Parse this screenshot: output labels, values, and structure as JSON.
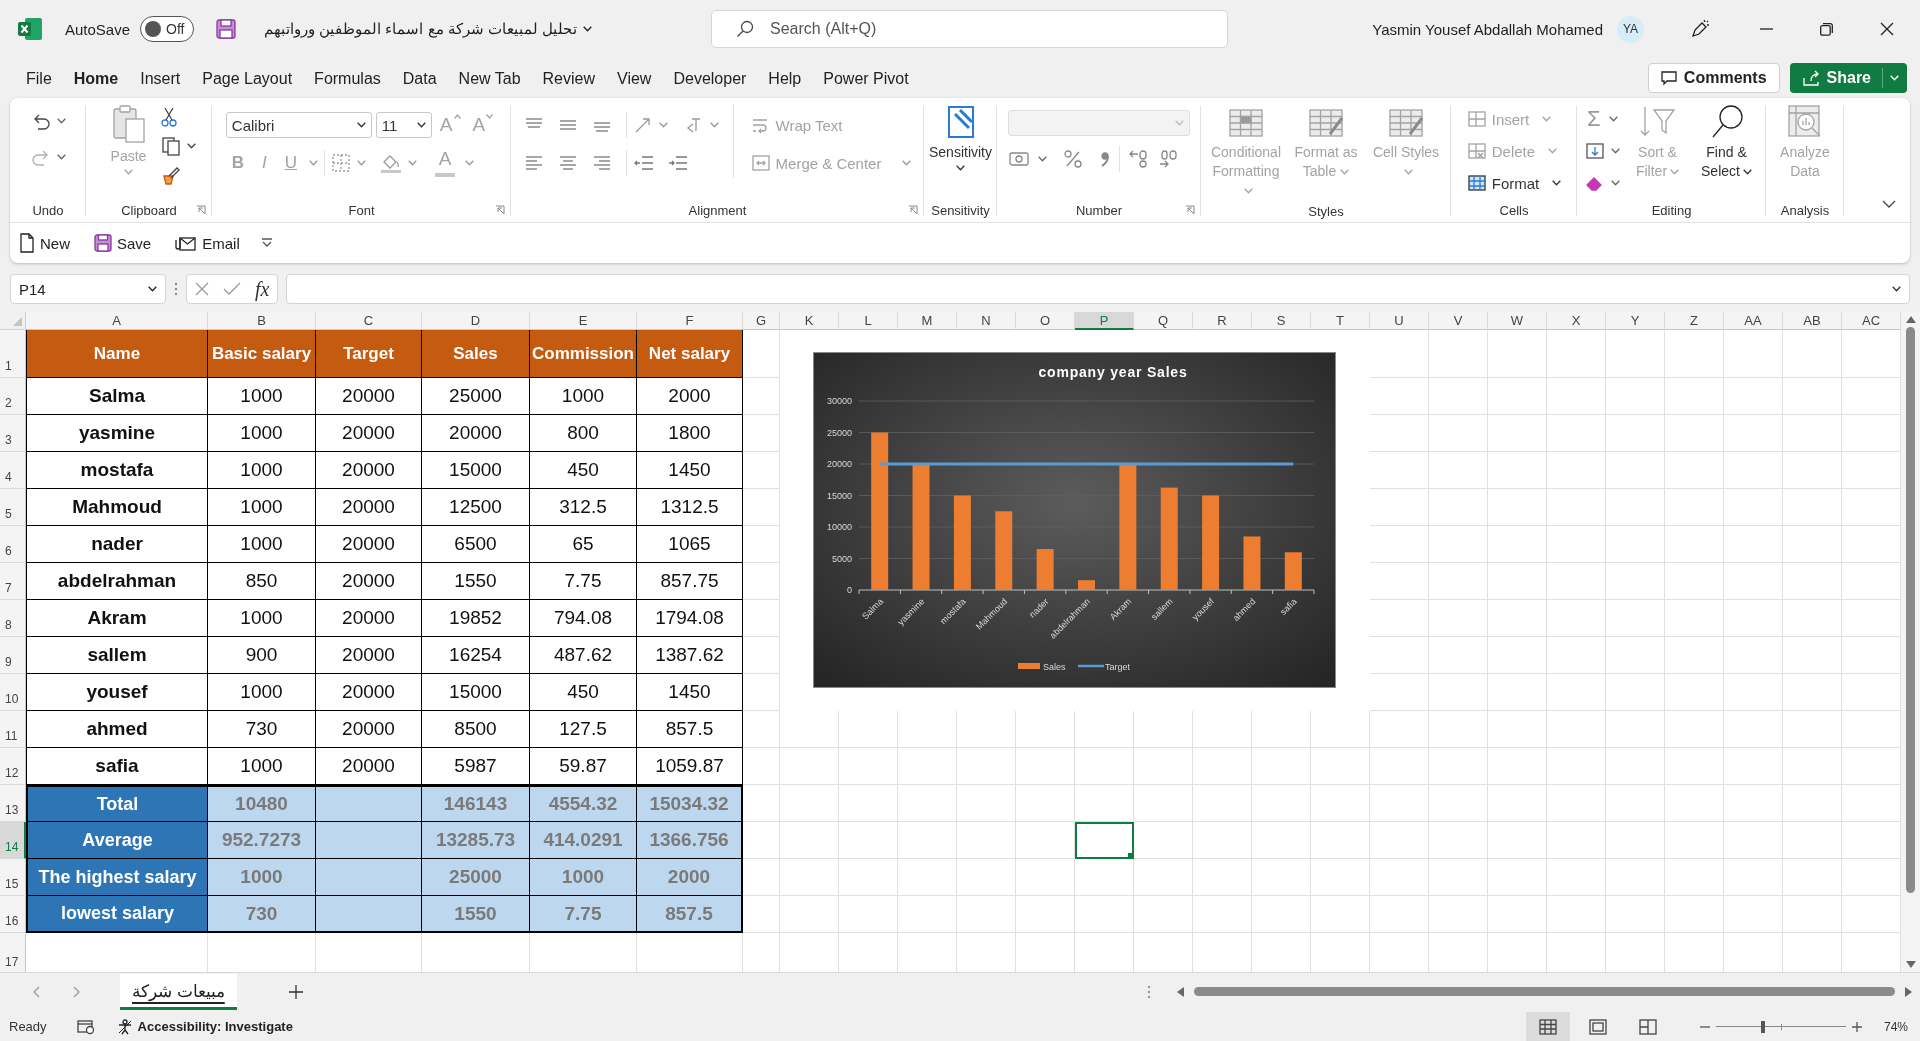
{
  "title_bar": {
    "autosave_label": "AutoSave",
    "autosave": {
      "on": false,
      "label": "Off"
    },
    "file_name": "تحليل لمبيعات شركة مع اسماء الموظفين ورواتبهم",
    "search": {
      "placeholder": "Search (Alt+Q)"
    },
    "user_name": "Yasmin Yousef Abdallah Mohamed",
    "avatar_initials": "YA"
  },
  "menu_tabs": [
    {
      "label": "File",
      "selected": false
    },
    {
      "label": "Home",
      "selected": true
    },
    {
      "label": "Insert",
      "selected": false
    },
    {
      "label": "Page Layout",
      "selected": false
    },
    {
      "label": "Formulas",
      "selected": false
    },
    {
      "label": "Data",
      "selected": false
    },
    {
      "label": "New Tab",
      "selected": false
    },
    {
      "label": "Review",
      "selected": false
    },
    {
      "label": "View",
      "selected": false
    },
    {
      "label": "Developer",
      "selected": false
    },
    {
      "label": "Help",
      "selected": false
    },
    {
      "label": "Power Pivot",
      "selected": false
    }
  ],
  "comments_button": "Comments",
  "share_button": "Share",
  "ribbon": {
    "groups": [
      {
        "kind": "undo",
        "label": "Undo",
        "launcher": false,
        "items": [
          {
            "disabled": false
          },
          {
            "disabled": true
          }
        ]
      },
      {
        "kind": "clipboard",
        "label": "Clipboard",
        "launcher": true,
        "paste": {
          "label": "Paste",
          "disabled": true
        }
      },
      {
        "kind": "font",
        "label": "Font",
        "launcher": true,
        "font_name": "Calibri",
        "font_size": "11",
        "size_buttons": [
          "A",
          "A"
        ],
        "style_buttons": [
          "B",
          "I",
          "U"
        ],
        "font_color": "A"
      },
      {
        "kind": "alignment",
        "label": "Alignment",
        "launcher": true,
        "buttons": [
          {
            "label": "Wrap Text",
            "disabled": true
          },
          {
            "label": "Merge & Center",
            "disabled": true
          }
        ]
      },
      {
        "kind": "large",
        "label": "Sensitivity",
        "launcher": false,
        "buttons": [
          {
            "label": "Sensitivity",
            "disabled": false
          }
        ]
      },
      {
        "kind": "number",
        "label": "Number",
        "launcher": true
      },
      {
        "kind": "large",
        "label": "Styles",
        "launcher": false,
        "buttons": [
          {
            "label": "Conditional Formatting",
            "disabled": true
          },
          {
            "label": "Format as Table",
            "disabled": true
          },
          {
            "label": "Cell Styles",
            "disabled": true
          }
        ]
      },
      {
        "kind": "cells",
        "label": "Cells",
        "launcher": false,
        "buttons": [
          {
            "label": "Insert",
            "disabled": true
          },
          {
            "label": "Delete",
            "disabled": true
          },
          {
            "label": "Format",
            "disabled": false
          }
        ]
      },
      {
        "kind": "editing",
        "label": "Editing",
        "launcher": false,
        "autosum": "Σ",
        "buttons": [
          {
            "label": "Sort & Filter",
            "disabled": true
          },
          {
            "label": "Find & Select",
            "disabled": false
          }
        ]
      },
      {
        "kind": "large",
        "label": "Analysis",
        "launcher": false,
        "buttons": [
          {
            "label": "Analyze Data",
            "disabled": true
          }
        ]
      }
    ]
  },
  "quick_access": [
    {
      "label": "New"
    },
    {
      "label": "Save"
    },
    {
      "label": "Email"
    }
  ],
  "formula_bar": {
    "name_box": "P14",
    "function_label": "fx"
  },
  "sheet": {
    "columns": [
      {
        "label": "A",
        "selected": false
      },
      {
        "label": "B",
        "selected": false
      },
      {
        "label": "C",
        "selected": false
      },
      {
        "label": "D",
        "selected": false
      },
      {
        "label": "E",
        "selected": false
      },
      {
        "label": "F",
        "selected": false
      },
      {
        "label": "G",
        "selected": false
      },
      {
        "label": "K",
        "selected": false
      },
      {
        "label": "L",
        "selected": false
      },
      {
        "label": "M",
        "selected": false
      },
      {
        "label": "N",
        "selected": false
      },
      {
        "label": "O",
        "selected": false
      },
      {
        "label": "P",
        "selected": true
      },
      {
        "label": "Q",
        "selected": false
      },
      {
        "label": "R",
        "selected": false
      },
      {
        "label": "S",
        "selected": false
      },
      {
        "label": "T",
        "selected": false
      },
      {
        "label": "U",
        "selected": false
      },
      {
        "label": "V",
        "selected": false
      },
      {
        "label": "W",
        "selected": false
      },
      {
        "label": "X",
        "selected": false
      },
      {
        "label": "Y",
        "selected": false
      },
      {
        "label": "Z",
        "selected": false
      },
      {
        "label": "AA",
        "selected": false
      },
      {
        "label": "AB",
        "selected": false
      },
      {
        "label": "AC",
        "selected": false
      }
    ],
    "rows": [
      {
        "label": "1",
        "selected": false
      },
      {
        "label": "2",
        "selected": false
      },
      {
        "label": "3",
        "selected": false
      },
      {
        "label": "4",
        "selected": false
      },
      {
        "label": "5",
        "selected": false
      },
      {
        "label": "6",
        "selected": false
      },
      {
        "label": "7",
        "selected": false
      },
      {
        "label": "8",
        "selected": false
      },
      {
        "label": "9",
        "selected": false
      },
      {
        "label": "10",
        "selected": false
      },
      {
        "label": "11",
        "selected": false
      },
      {
        "label": "12",
        "selected": false
      },
      {
        "label": "13",
        "selected": false
      },
      {
        "label": "14",
        "selected": true
      },
      {
        "label": "15",
        "selected": false
      },
      {
        "label": "16",
        "selected": false
      },
      {
        "label": "17",
        "selected": false
      }
    ],
    "table": {
      "columns": [
        "Name",
        "Basic salary",
        "Target",
        "Sales",
        "Commission",
        "Net salary"
      ],
      "rows": [
        {
          "cells": [
            "Salma",
            "1000",
            "20000",
            "25000",
            "1000",
            "2000"
          ]
        },
        {
          "cells": [
            "yasmine",
            "1000",
            "20000",
            "20000",
            "800",
            "1800"
          ]
        },
        {
          "cells": [
            "mostafa",
            "1000",
            "20000",
            "15000",
            "450",
            "1450"
          ]
        },
        {
          "cells": [
            "Mahmoud",
            "1000",
            "20000",
            "12500",
            "312.5",
            "1312.5"
          ]
        },
        {
          "cells": [
            "nader",
            "1000",
            "20000",
            "6500",
            "65",
            "1065"
          ]
        },
        {
          "cells": [
            "abdelrahman",
            "850",
            "20000",
            "1550",
            "7.75",
            "857.75"
          ]
        },
        {
          "cells": [
            "Akram",
            "1000",
            "20000",
            "19852",
            "794.08",
            "1794.08"
          ]
        },
        {
          "cells": [
            "sallem",
            "900",
            "20000",
            "16254",
            "487.62",
            "1387.62"
          ]
        },
        {
          "cells": [
            "yousef",
            "1000",
            "20000",
            "15000",
            "450",
            "1450"
          ]
        },
        {
          "cells": [
            "ahmed",
            "730",
            "20000",
            "8500",
            "127.5",
            "857.5"
          ]
        },
        {
          "cells": [
            "safia",
            "1000",
            "20000",
            "5987",
            "59.87",
            "1059.87"
          ]
        }
      ],
      "summary": [
        {
          "label": "Total",
          "cells": [
            "10480",
            null,
            "146143",
            "4554.32",
            "15034.32"
          ]
        },
        {
          "label": "Average",
          "cells": [
            "952.7273",
            null,
            "13285.73",
            "414.0291",
            "1366.756"
          ]
        },
        {
          "label": "The highest salary",
          "cells": [
            "1000",
            null,
            "25000",
            "1000",
            "2000"
          ]
        },
        {
          "label": "lowest salary",
          "cells": [
            "730",
            null,
            "1550",
            "7.75",
            "857.5"
          ]
        }
      ]
    },
    "chart": {
      "chart_data": {
        "type": "bar",
        "title": "company year Sales",
        "categories": [
          "Salma",
          "yasmine",
          "mostafa",
          "Mahmoud",
          "nader",
          "abdelrahman",
          "Akram",
          "sallem",
          "yousef",
          "ahmed",
          "safia"
        ],
        "ylim": [
          0,
          30000
        ],
        "grid": true,
        "legend": true,
        "yticks": [
          {
            "value": 0,
            "label": "0"
          },
          {
            "value": 5000,
            "label": "5000"
          },
          {
            "value": 10000,
            "label": "10000"
          },
          {
            "value": 15000,
            "label": "15000"
          },
          {
            "value": 20000,
            "label": "20000"
          },
          {
            "value": 25000,
            "label": "25000"
          },
          {
            "value": 30000,
            "label": "30000"
          }
        ],
        "series": [
          {
            "name": "Sales",
            "type": "bar",
            "color": "#ed7d31",
            "values": [
              25000,
              20000,
              15000,
              12500,
              6500,
              1550,
              19852,
              16254,
              15000,
              8500,
              5987
            ]
          },
          {
            "name": "Target",
            "type": "line",
            "color": "#5b9bd5",
            "values": [
              20000,
              20000,
              20000,
              20000,
              20000,
              20000,
              20000,
              20000,
              20000,
              20000,
              20000
            ]
          }
        ]
      }
    }
  },
  "sheet_tabs": [
    {
      "label": "مبيعات شركة",
      "selected": true
    }
  ],
  "status_bar": {
    "status": "Ready",
    "accessibility": "Accessibility: Investigate",
    "views": [
      {
        "selected": true
      },
      {
        "selected": false
      },
      {
        "selected": false
      }
    ],
    "zoom_slider": {
      "level": 0.36
    },
    "zoom": "74%"
  }
}
